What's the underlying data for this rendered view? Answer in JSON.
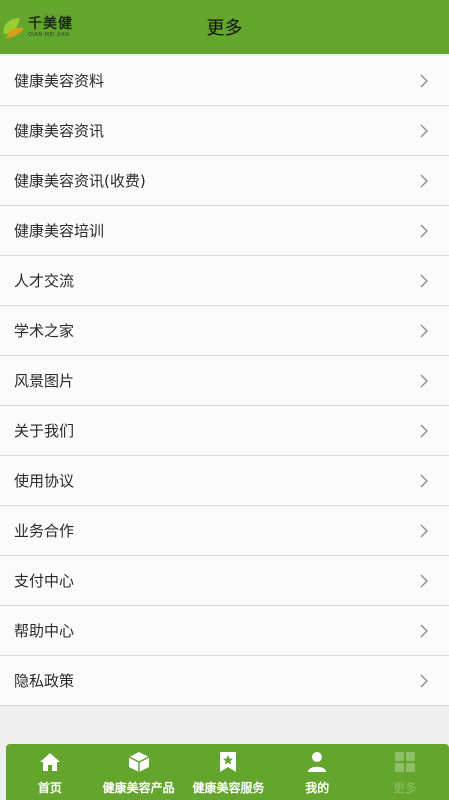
{
  "header": {
    "title": "更多",
    "logo_text": "千美健",
    "logo_sub": "QIAN MEI JIAN"
  },
  "menu": [
    {
      "label": "健康美容资料"
    },
    {
      "label": "健康美容资讯"
    },
    {
      "label": "健康美容资讯(收费)"
    },
    {
      "label": "健康美容培训"
    },
    {
      "label": "人才交流"
    },
    {
      "label": "学术之家"
    },
    {
      "label": "风景图片"
    },
    {
      "label": "关于我们"
    },
    {
      "label": "使用协议"
    },
    {
      "label": "业务合作"
    },
    {
      "label": "支付中心"
    },
    {
      "label": "帮助中心"
    },
    {
      "label": "隐私政策"
    }
  ],
  "tabbar": {
    "items": [
      {
        "label": "首页",
        "icon": "home-icon"
      },
      {
        "label": "健康美容产品",
        "icon": "box-icon"
      },
      {
        "label": "健康美容服务",
        "icon": "bookmark-star-icon"
      },
      {
        "label": "我的",
        "icon": "user-icon"
      },
      {
        "label": "更多",
        "icon": "grid-icon",
        "active": true
      }
    ]
  },
  "colors": {
    "brand_green": "#63a52d",
    "active_tab": "#8fbf69"
  }
}
